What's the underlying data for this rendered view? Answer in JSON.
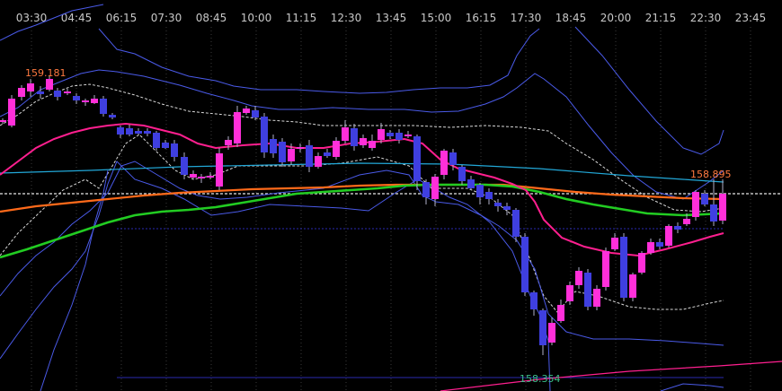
{
  "chart_data": {
    "type": "candlestick",
    "x_ticks": [
      "03:30",
      "04:45",
      "06:15",
      "07:30",
      "08:45",
      "10:00",
      "11:15",
      "12:30",
      "13:45",
      "15:00",
      "16:15",
      "17:30",
      "18:45",
      "20:00",
      "21:15",
      "22:30",
      "23:45"
    ],
    "annotations": {
      "high_label": "159.181",
      "current_label": "158.895",
      "low_label": "158.354"
    },
    "colors": {
      "background": "#000000",
      "grid": "#3a3a3a",
      "bull": "#ff2fd9",
      "bear": "#3f3fe0",
      "bollinger_outer": "#4a5ae8",
      "bollinger_inner": "#d8d8d8",
      "ma_short": "#ff1f8f",
      "ma_medium": "#ff6a1a",
      "ma_long": "#22cc22",
      "ma_cyan": "#22a8d8",
      "high_label": "#ff7a40",
      "current_label": "#ff7a40",
      "low_label": "#3bbf8a"
    }
  }
}
